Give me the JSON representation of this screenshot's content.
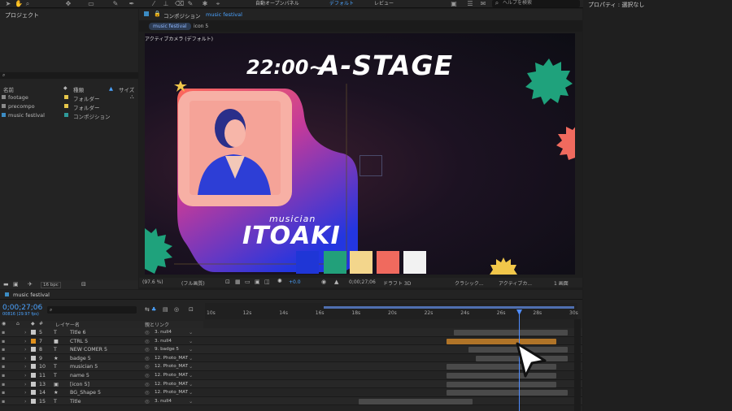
{
  "toolbar": {
    "workspace_auto_open": "自動オープンパネル",
    "workspace_default": "デフォルト",
    "workspace_review": "レビュー",
    "help_search_placeholder": "ヘルプを検索"
  },
  "project_panel": {
    "title": "プロジェクト",
    "columns": {
      "name": "名前",
      "type": "種類",
      "size": "サイズ"
    },
    "items": [
      {
        "name": "footage",
        "type": "フォルダー",
        "label_color": "#e6c64a"
      },
      {
        "name": "precompo",
        "type": "フォルダー",
        "label_color": "#e6c64a"
      },
      {
        "name": "music festival",
        "type": "コンポジション",
        "label_color": "#2f9a9a"
      }
    ],
    "bpc": "16 bpc"
  },
  "composition_panel": {
    "title": "コンポジション",
    "comp_name": "music festival",
    "breadcrumbs": [
      "music festival",
      "icon 5"
    ],
    "camera_label": "アクティブカメラ (デフォルト)",
    "status": {
      "zoom": "(97.6 %)",
      "resolution": "(フル画質)",
      "exposure": "+0.0",
      "timecode": "0;00;27;06",
      "renderer": "ドラフト 3D",
      "renderer_mode": "クラシック...",
      "camera": "アクティブカ...",
      "views": "1 画面"
    },
    "artwork": {
      "heading_time": "22:00~",
      "heading_stage": "A-STAGE",
      "subtitle": "musician",
      "name": "ITOAKI",
      "swatches": [
        "#1f36d6",
        "#22a07a",
        "#f3d68c",
        "#f06a5e",
        "#f2f2f2"
      ],
      "shape_green": "#1fa27c",
      "shape_coral": "#f06a5e",
      "shape_yellow": "#f1c74a"
    }
  },
  "properties_panel": {
    "title": "プロパティ : 選択なし"
  },
  "timeline": {
    "comp_tab": "music festival",
    "current_time": "0;00;27;06",
    "frame_info": "00816 (29.97 fps)",
    "header": {
      "layer_name": "レイヤー名",
      "parent": "親とリンク"
    },
    "ruler": [
      "10s",
      "12s",
      "14s",
      "16s",
      "18s",
      "20s",
      "22s",
      "24s",
      "26s",
      "28s",
      "30s"
    ],
    "layers": [
      {
        "num": "5",
        "type": "T",
        "name": "Title 6",
        "parent": "3. null4",
        "label": "#c8c8c8",
        "bar_start": 0.68,
        "bar_end": 0.99,
        "bar_color": "#4a4a4a"
      },
      {
        "num": "7",
        "type": "■",
        "name": "CTRL 5",
        "parent": "3. null4",
        "label": "#e0901c",
        "bar_start": 0.66,
        "bar_end": 0.96,
        "bar_color": "#b07428"
      },
      {
        "num": "8",
        "type": "T",
        "name": "NEW COMER 5",
        "parent": "9. badge 5",
        "label": "#c8c8c8",
        "bar_start": 0.72,
        "bar_end": 0.99,
        "bar_color": "#4a4a4a"
      },
      {
        "num": "9",
        "type": "★",
        "name": "badge 5",
        "parent": "12. Photo_MAT",
        "label": "#c8c8c8",
        "bar_start": 0.74,
        "bar_end": 0.99,
        "bar_color": "#4a4a4a"
      },
      {
        "num": "10",
        "type": "T",
        "name": "musician 5",
        "parent": "12. Photo_MAT",
        "label": "#c8c8c8",
        "bar_start": 0.66,
        "bar_end": 0.96,
        "bar_color": "#4a4a4a"
      },
      {
        "num": "11",
        "type": "T",
        "name": "name 5",
        "parent": "12. Photo_MAT",
        "label": "#c8c8c8",
        "bar_start": 0.66,
        "bar_end": 0.96,
        "bar_color": "#4a4a4a"
      },
      {
        "num": "13",
        "type": "▣",
        "name": "[icon 5]",
        "parent": "12. Photo_MAT",
        "label": "#c8c8c8",
        "bar_start": 0.66,
        "bar_end": 0.96,
        "bar_color": "#4a4a4a"
      },
      {
        "num": "14",
        "type": "★",
        "name": "BG_Shape 5",
        "parent": "12. Photo_MAT",
        "label": "#c8c8c8",
        "bar_start": 0.66,
        "bar_end": 0.99,
        "bar_color": "#4a4a4a"
      },
      {
        "num": "15",
        "type": "T",
        "name": "Title",
        "parent": "3. null4",
        "label": "#c8c8c8",
        "bar_start": 0.42,
        "bar_end": 0.73,
        "bar_color": "#4a4a4a"
      }
    ]
  }
}
